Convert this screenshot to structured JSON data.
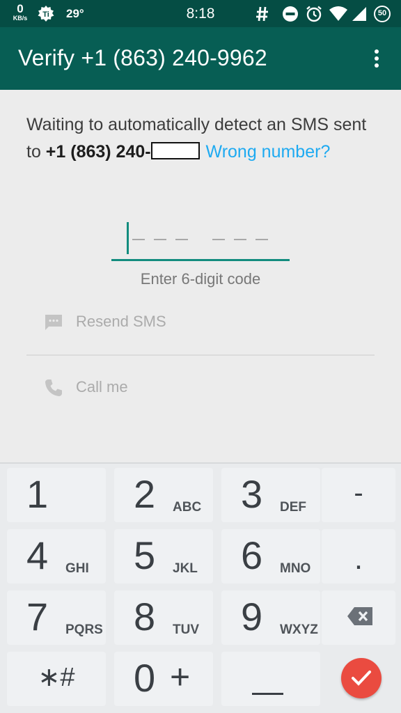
{
  "status_bar": {
    "net_speed": "0",
    "net_speed_unit": "KB/s",
    "temperature": "29°",
    "time": "8:18",
    "battery": "50"
  },
  "toolbar": {
    "title": "Verify +1 (863) 240-9962",
    "more_icon": "more-vert-icon"
  },
  "message": {
    "text": "Waiting to automatically detect an SMS sent to ",
    "number": "+1 (863) 240-",
    "wrong_number": "Wrong number?"
  },
  "code": {
    "hint": "Enter 6-digit code",
    "value": ""
  },
  "options": {
    "resend_sms": "Resend SMS",
    "call_me": "Call me"
  },
  "keypad": {
    "keys": [
      {
        "digit": "1",
        "letters": ""
      },
      {
        "digit": "2",
        "letters": "ABC"
      },
      {
        "digit": "3",
        "letters": "DEF"
      },
      {
        "digit": "4",
        "letters": "GHI"
      },
      {
        "digit": "5",
        "letters": "JKL"
      },
      {
        "digit": "6",
        "letters": "MNO"
      },
      {
        "digit": "7",
        "letters": "PQRS"
      },
      {
        "digit": "8",
        "letters": "TUV"
      },
      {
        "digit": "9",
        "letters": "WXYZ"
      },
      {
        "digit": "0",
        "letters": "+"
      }
    ],
    "minus": "-",
    "period": ".",
    "star_hash": "∗#",
    "space": "⎵",
    "delete_icon": "backspace-icon",
    "confirm_icon": "check-icon"
  },
  "colors": {
    "status_bar": "#054d44",
    "toolbar": "#075e54",
    "accent": "#128c7e",
    "link": "#1eaaf1",
    "confirm": "#ea4b40"
  }
}
